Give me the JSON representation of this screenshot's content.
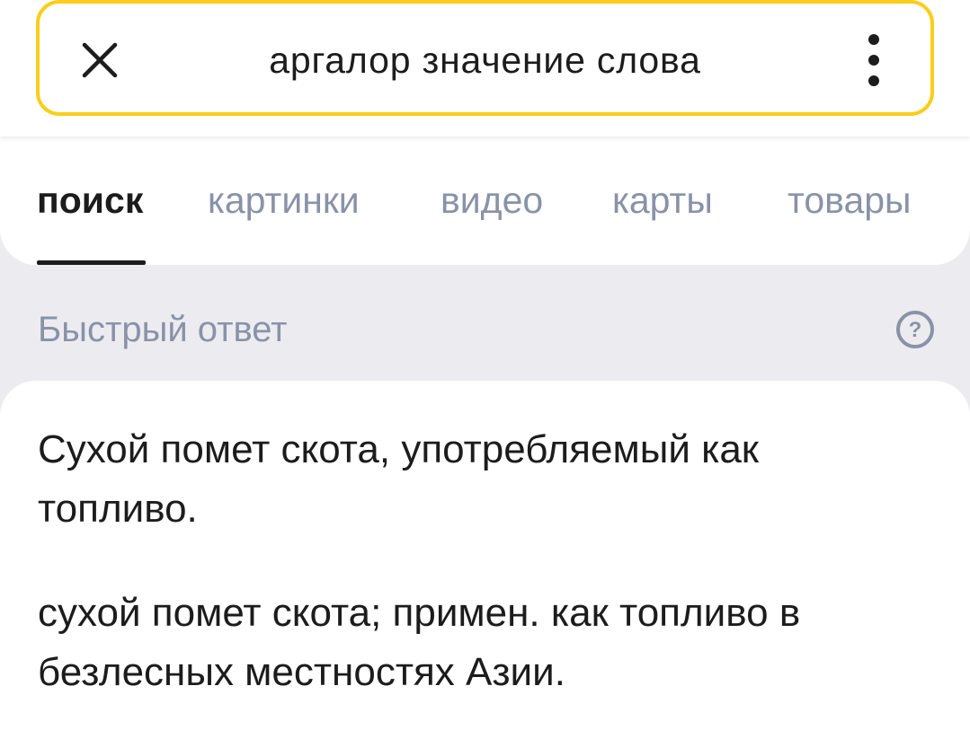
{
  "search": {
    "query": "аргалор значение слова",
    "close_icon": "close-icon",
    "more_icon": "more-vertical-icon"
  },
  "tabs": [
    {
      "label": "поиск",
      "active": true
    },
    {
      "label": "картинки",
      "active": false
    },
    {
      "label": "видео",
      "active": false
    },
    {
      "label": "карты",
      "active": false
    },
    {
      "label": "товары",
      "active": false
    }
  ],
  "quick_answer": {
    "title": "Быстрый ответ",
    "help_icon": "help-icon",
    "definitions": [
      "Сухой помет скота, употребляемый как топливо.",
      "сухой помет скота; примен. как топливо в безлесных местностях Азии."
    ]
  },
  "colors": {
    "search_border": "#fccd1a",
    "active_tab": "#1c1c1c",
    "inactive_tab": "#8a92a8",
    "background": "#ececf0"
  }
}
